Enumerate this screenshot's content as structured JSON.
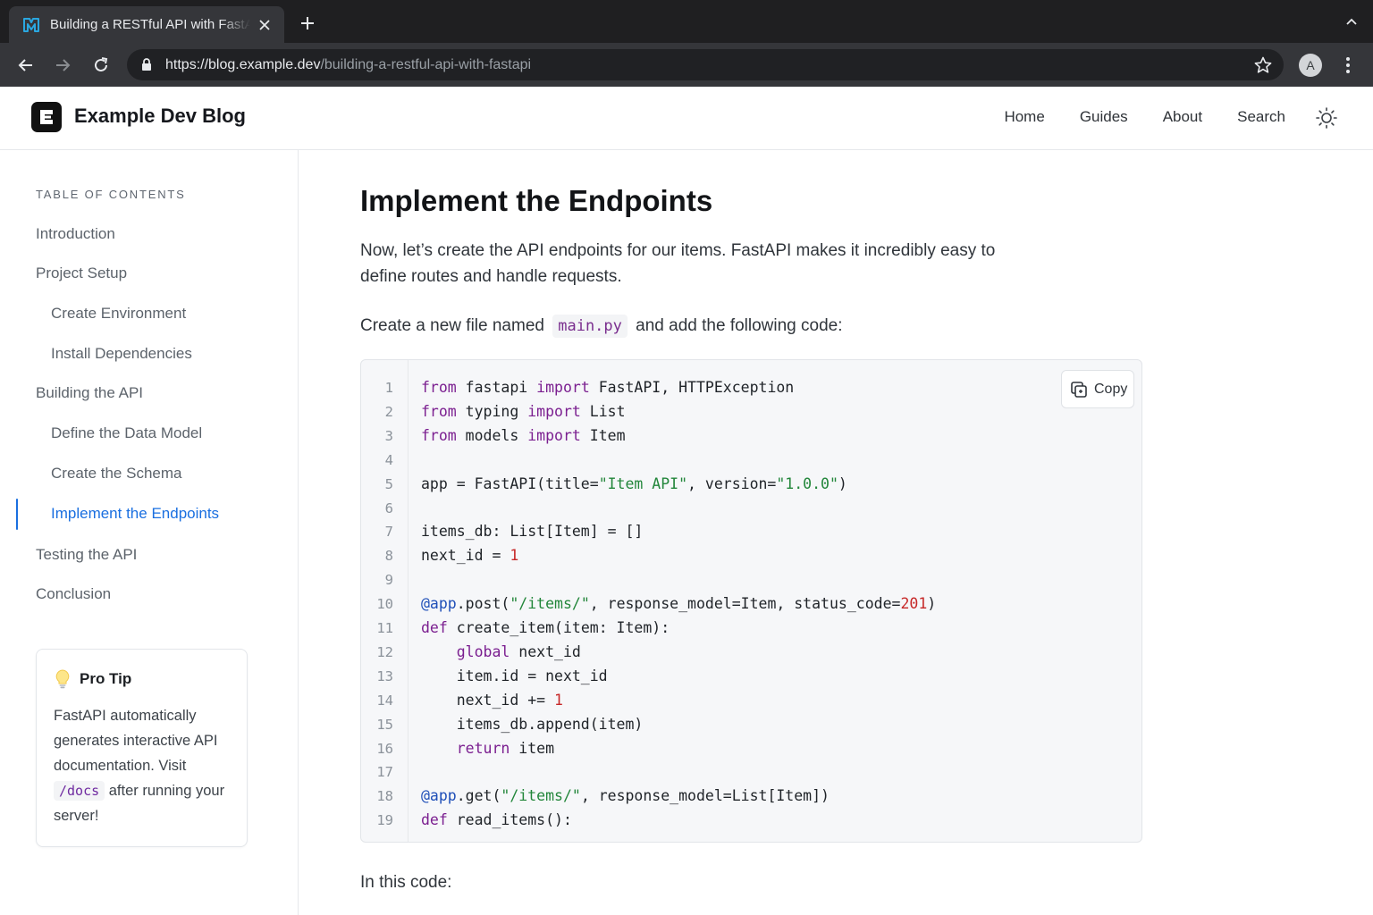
{
  "browser": {
    "tab_title": "Building a RESTful API with FastAPI",
    "url_host": "https://blog.example.dev",
    "url_path": "/building-a-restful-api-with-fastapi",
    "profile_initial": "A"
  },
  "site": {
    "brand": "Example Dev Blog",
    "nav": [
      "Home",
      "Guides",
      "About",
      "Search"
    ]
  },
  "toc": {
    "heading": "TABLE OF CONTENTS",
    "items": [
      {
        "label": "Introduction",
        "level": 1
      },
      {
        "label": "Project Setup",
        "level": 1
      },
      {
        "label": "Create Environment",
        "level": 2
      },
      {
        "label": "Install Dependencies",
        "level": 2
      },
      {
        "label": "Building the API",
        "level": 1
      },
      {
        "label": "Define the Data Model",
        "level": 2
      },
      {
        "label": "Create the Schema",
        "level": 2
      },
      {
        "label": "Implement the Endpoints",
        "level": 2,
        "active": true
      },
      {
        "label": "Testing the API",
        "level": 1
      },
      {
        "label": "Conclusion",
        "level": 1
      }
    ]
  },
  "tip": {
    "title": "Pro Tip",
    "text_before": "FastAPI automatically generates interactive API documentation. Visit",
    "code": "/docs",
    "text_after": "after running your server!"
  },
  "article": {
    "heading": "Implement the Endpoints",
    "intro": "Now, let’s create the API endpoints for our items. FastAPI makes it incredibly easy to define routes and handle requests.",
    "file_before": "Create a new file named",
    "file_name": "main.py",
    "file_after": "and add the following code:",
    "outro": "In this code:"
  },
  "code": {
    "copy_label": "Copy",
    "lines": [
      [
        [
          "kw",
          "from"
        ],
        [
          "t",
          " fastapi "
        ],
        [
          "kw",
          "import"
        ],
        [
          "t",
          " FastAPI, HTTPException"
        ]
      ],
      [
        [
          "kw",
          "from"
        ],
        [
          "t",
          " typing "
        ],
        [
          "kw",
          "import"
        ],
        [
          "t",
          " List"
        ]
      ],
      [
        [
          "kw",
          "from"
        ],
        [
          "t",
          " models "
        ],
        [
          "kw",
          "import"
        ],
        [
          "t",
          " Item"
        ]
      ],
      [],
      [
        [
          "t",
          "app = FastAPI(title="
        ],
        [
          "str",
          "\"Item API\""
        ],
        [
          "t",
          ", version="
        ],
        [
          "str",
          "\"1.0.0\""
        ],
        [
          "t",
          ")"
        ]
      ],
      [],
      [
        [
          "t",
          "items_db: List[Item] = []"
        ]
      ],
      [
        [
          "t",
          "next_id = "
        ],
        [
          "num",
          "1"
        ]
      ],
      [],
      [
        [
          "deco",
          "@app"
        ],
        [
          "t",
          ".post("
        ],
        [
          "str",
          "\"/items/\""
        ],
        [
          "t",
          ", response_model=Item, status_code="
        ],
        [
          "num",
          "201"
        ],
        [
          "t",
          ")"
        ]
      ],
      [
        [
          "kw",
          "def"
        ],
        [
          "t",
          " create_item(item: Item):"
        ]
      ],
      [
        [
          "t",
          "    "
        ],
        [
          "kw",
          "global"
        ],
        [
          "t",
          " next_id"
        ]
      ],
      [
        [
          "t",
          "    item.id = next_id"
        ]
      ],
      [
        [
          "t",
          "    next_id += "
        ],
        [
          "num",
          "1"
        ]
      ],
      [
        [
          "t",
          "    items_db.append(item)"
        ]
      ],
      [
        [
          "t",
          "    "
        ],
        [
          "kw",
          "return"
        ],
        [
          "t",
          " item"
        ]
      ],
      [],
      [
        [
          "deco",
          "@app"
        ],
        [
          "t",
          ".get("
        ],
        [
          "str",
          "\"/items/\""
        ],
        [
          "t",
          ", response_model=List[Item])"
        ]
      ],
      [
        [
          "kw",
          "def"
        ],
        [
          "t",
          " read_items():"
        ]
      ]
    ]
  },
  "colors": {
    "accent": "#1a6fe0",
    "keyword": "#7b1f90",
    "string": "#22863a",
    "number": "#c62828",
    "decorator": "#1f4fb8"
  }
}
